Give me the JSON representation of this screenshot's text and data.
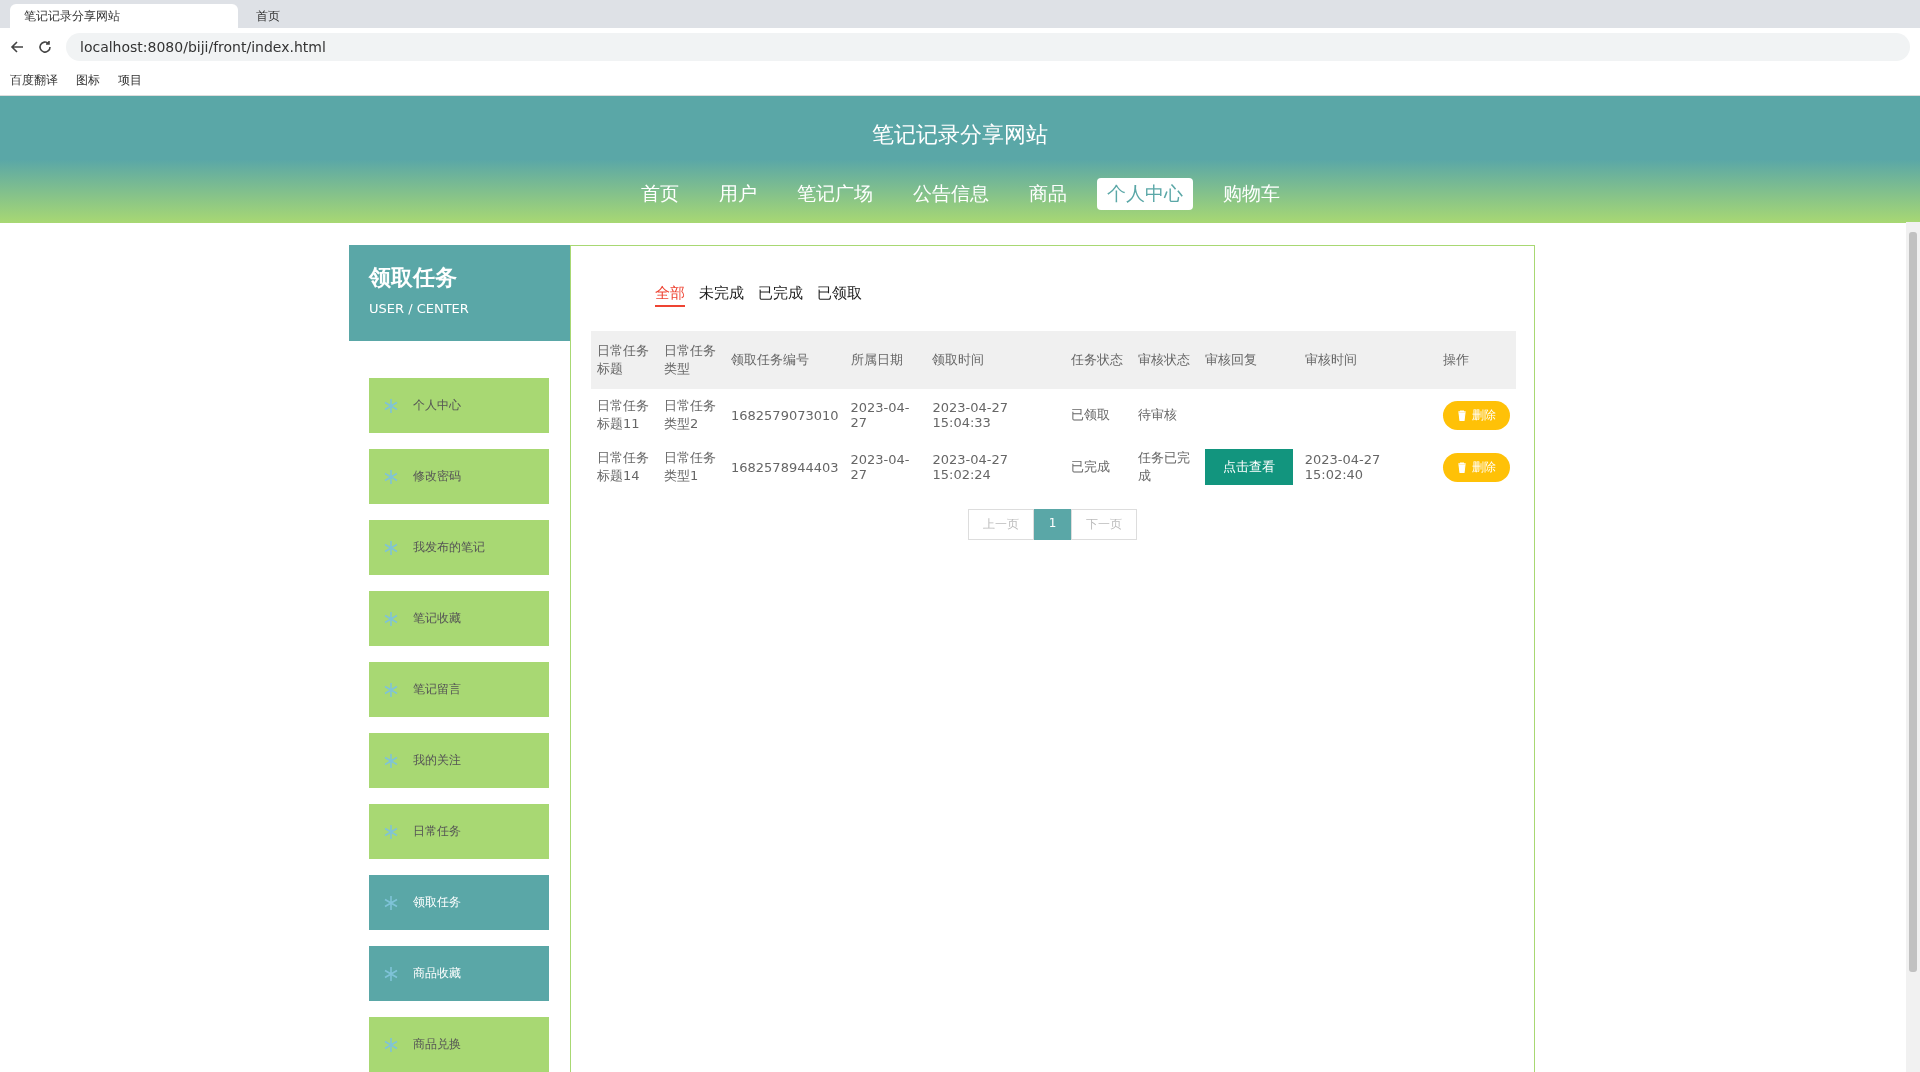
{
  "browser": {
    "tabs": [
      {
        "title": "笔记记录分享网站",
        "selected": true
      },
      {
        "title": "首页",
        "selected": false
      }
    ],
    "url": "localhost:8080/biji/front/index.html",
    "bookmarks": [
      "百度翻译",
      "图标",
      "项目"
    ]
  },
  "site": {
    "title": "笔记记录分享网站",
    "nav": [
      {
        "label": "首页",
        "selected": false
      },
      {
        "label": "用户",
        "selected": false
      },
      {
        "label": "笔记广场",
        "selected": false
      },
      {
        "label": "公告信息",
        "selected": false
      },
      {
        "label": "商品",
        "selected": false
      },
      {
        "label": "个人中心",
        "selected": true
      },
      {
        "label": "购物车",
        "selected": false
      }
    ]
  },
  "sidebar": {
    "title": "领取任务",
    "subtitle": "USER / CENTER",
    "items": [
      {
        "label": "个人中心",
        "selected": false
      },
      {
        "label": "修改密码",
        "selected": false
      },
      {
        "label": "我发布的笔记",
        "selected": false
      },
      {
        "label": "笔记收藏",
        "selected": false
      },
      {
        "label": "笔记留言",
        "selected": false
      },
      {
        "label": "我的关注",
        "selected": false
      },
      {
        "label": "日常任务",
        "selected": false
      },
      {
        "label": "领取任务",
        "selected": true
      },
      {
        "label": "商品收藏",
        "selected": true
      },
      {
        "label": "商品兑换",
        "selected": false
      }
    ]
  },
  "filters": [
    {
      "label": "全部",
      "selected": true
    },
    {
      "label": "未完成",
      "selected": false
    },
    {
      "label": "已完成",
      "selected": false
    },
    {
      "label": "已领取",
      "selected": false
    }
  ],
  "table": {
    "columns": [
      "日常任务标题",
      "日常任务类型",
      "领取任务编号",
      "所属日期",
      "领取时间",
      "任务状态",
      "审核状态",
      "审核回复",
      "审核时间",
      "操作"
    ],
    "rows": [
      {
        "cells": [
          "日常任务标题11",
          "日常任务类型2",
          "1682579073010",
          "2023-04-27",
          "2023-04-27 15:04:33",
          "已领取",
          "待审核"
        ],
        "reply_button": null,
        "review_time": null,
        "delete": "删除"
      },
      {
        "cells": [
          "日常任务标题14",
          "日常任务类型1",
          "1682578944403",
          "2023-04-27",
          "2023-04-27 15:02:24",
          "已完成",
          "任务已完成"
        ],
        "reply_button": "点击查看",
        "review_time": "2023-04-27 15:02:40",
        "delete": "删除"
      }
    ]
  },
  "pagination": {
    "prev": "上一页",
    "pages": [
      {
        "label": "1",
        "selected": true
      }
    ],
    "next": "下一页"
  }
}
